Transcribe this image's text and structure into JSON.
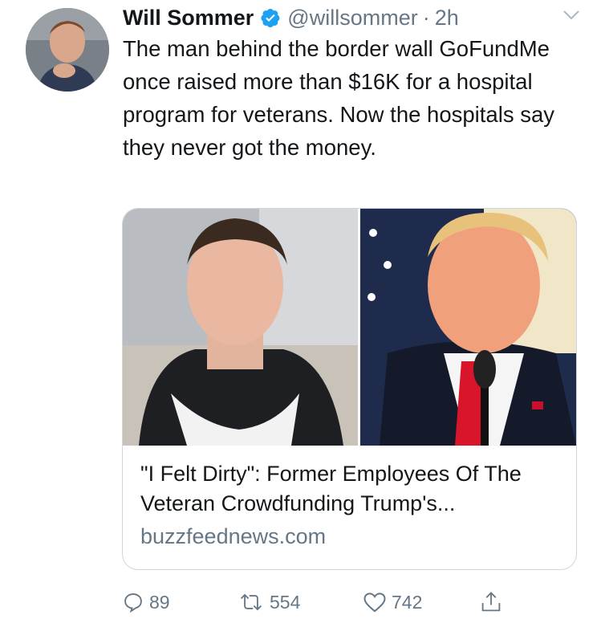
{
  "author": {
    "display_name": "Will Sommer",
    "handle": "@willsommer",
    "time": "2h",
    "separator": "·",
    "verified_icon": "verified-badge-icon",
    "avatar_icon": "avatar-photo"
  },
  "tweet": {
    "text": "The man behind the border wall GoFundMe once raised more than $16K for a hospital program for veterans. Now the hospitals say they never got the money."
  },
  "card": {
    "title": "\"I Felt Dirty\": Former Employees Of The Veteran Crowdfunding Trump's...",
    "domain": "buzzfeednews.com"
  },
  "actions": {
    "replies": "89",
    "retweets": "554",
    "likes": "742",
    "reply_icon": "reply-icon",
    "retweet_icon": "retweet-icon",
    "like_icon": "heart-icon",
    "share_icon": "share-icon"
  },
  "colors": {
    "text": "#14171a",
    "secondary": "#657786",
    "verified": "#1da1f2",
    "border": "#ccd6dd"
  }
}
